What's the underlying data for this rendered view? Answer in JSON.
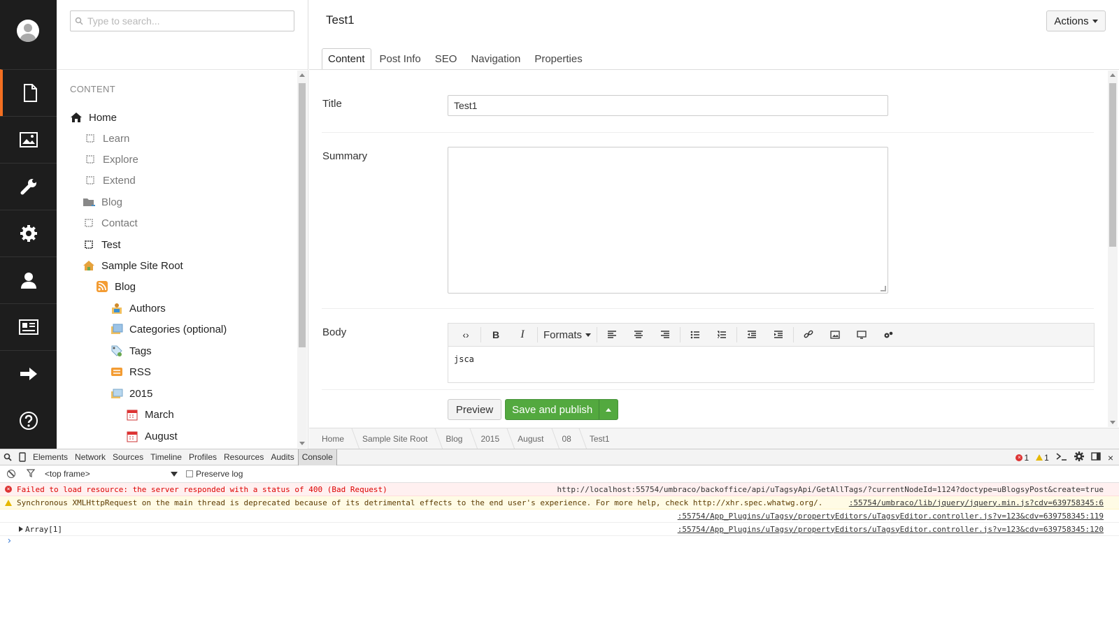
{
  "tree": {
    "search_placeholder": "Type to search...",
    "section_label": "CONTENT",
    "items": [
      {
        "label": "Home",
        "icon": "home-icon"
      },
      {
        "label": "Learn",
        "icon": "document-icon"
      },
      {
        "label": "Explore",
        "icon": "document-icon"
      },
      {
        "label": "Extend",
        "icon": "document-icon"
      },
      {
        "label": "Blog",
        "icon": "folder-icon"
      },
      {
        "label": "Contact",
        "icon": "document-icon"
      },
      {
        "label": "Test",
        "icon": "document-icon"
      },
      {
        "label": "Sample Site Root",
        "icon": "house-icon"
      },
      {
        "label": "Blog",
        "icon": "rss-icon"
      },
      {
        "label": "Authors",
        "icon": "authors-icon"
      },
      {
        "label": "Categories (optional)",
        "icon": "categories-icon"
      },
      {
        "label": "Tags",
        "icon": "tags-icon"
      },
      {
        "label": "RSS",
        "icon": "rss-feed-icon"
      },
      {
        "label": "2015",
        "icon": "folder-stack-icon"
      },
      {
        "label": "March",
        "icon": "calendar-icon"
      },
      {
        "label": "August",
        "icon": "calendar-icon"
      }
    ]
  },
  "editor": {
    "doc_title": "Test1",
    "actions_label": "Actions",
    "tabs": [
      "Content",
      "Post Info",
      "SEO",
      "Navigation",
      "Properties"
    ],
    "fields": {
      "title_label": "Title",
      "title_value": "Test1",
      "summary_label": "Summary",
      "summary_value": "",
      "body_label": "Body",
      "body_text": "jsca",
      "formats_label": "Formats"
    },
    "preview_label": "Preview",
    "save_publish_label": "Save and publish",
    "breadcrumb": [
      "Home",
      "Sample Site Root",
      "Blog",
      "2015",
      "August",
      "08",
      "Test1"
    ]
  },
  "devtools": {
    "tabs": [
      "Elements",
      "Network",
      "Sources",
      "Timeline",
      "Profiles",
      "Resources",
      "Audits",
      "Console"
    ],
    "error_count": "1",
    "warning_count": "1",
    "frame": "<top frame>",
    "preserve_log": "Preserve log",
    "lines": [
      {
        "type": "error",
        "msg": "Failed to load resource: the server responded with a status of 400 (Bad Request)",
        "src": "http://localhost:55754/umbraco/backoffice/api/uTagsyApi/GetAllTags/?currentNodeId=1124?doctype=uBlogsyPost&create=true"
      },
      {
        "type": "warn",
        "msg": "Synchronous XMLHttpRequest on the main thread is deprecated because of its detrimental effects to the end user's experience. For more help, check http://xhr.spec.whatwg.org/.",
        "src": ":55754/umbraco/lib/jquery/jquery.min.js?cdv=639758345:6"
      },
      {
        "type": "plain",
        "msg": "",
        "src": ":55754/App_Plugins/uTagsy/propertyEditors/uTagsyEditor.controller.js?v=123&cdv=639758345:119"
      },
      {
        "type": "plain",
        "msg": "Array[1]",
        "src": ":55754/App_Plugins/uTagsy/propertyEditors/uTagsyEditor.controller.js?v=123&cdv=639758345:120"
      }
    ],
    "prompt": "›"
  },
  "colors": {
    "accent": "#f36f21",
    "success": "#53a93f",
    "nav_bg": "#1d1d1d"
  }
}
